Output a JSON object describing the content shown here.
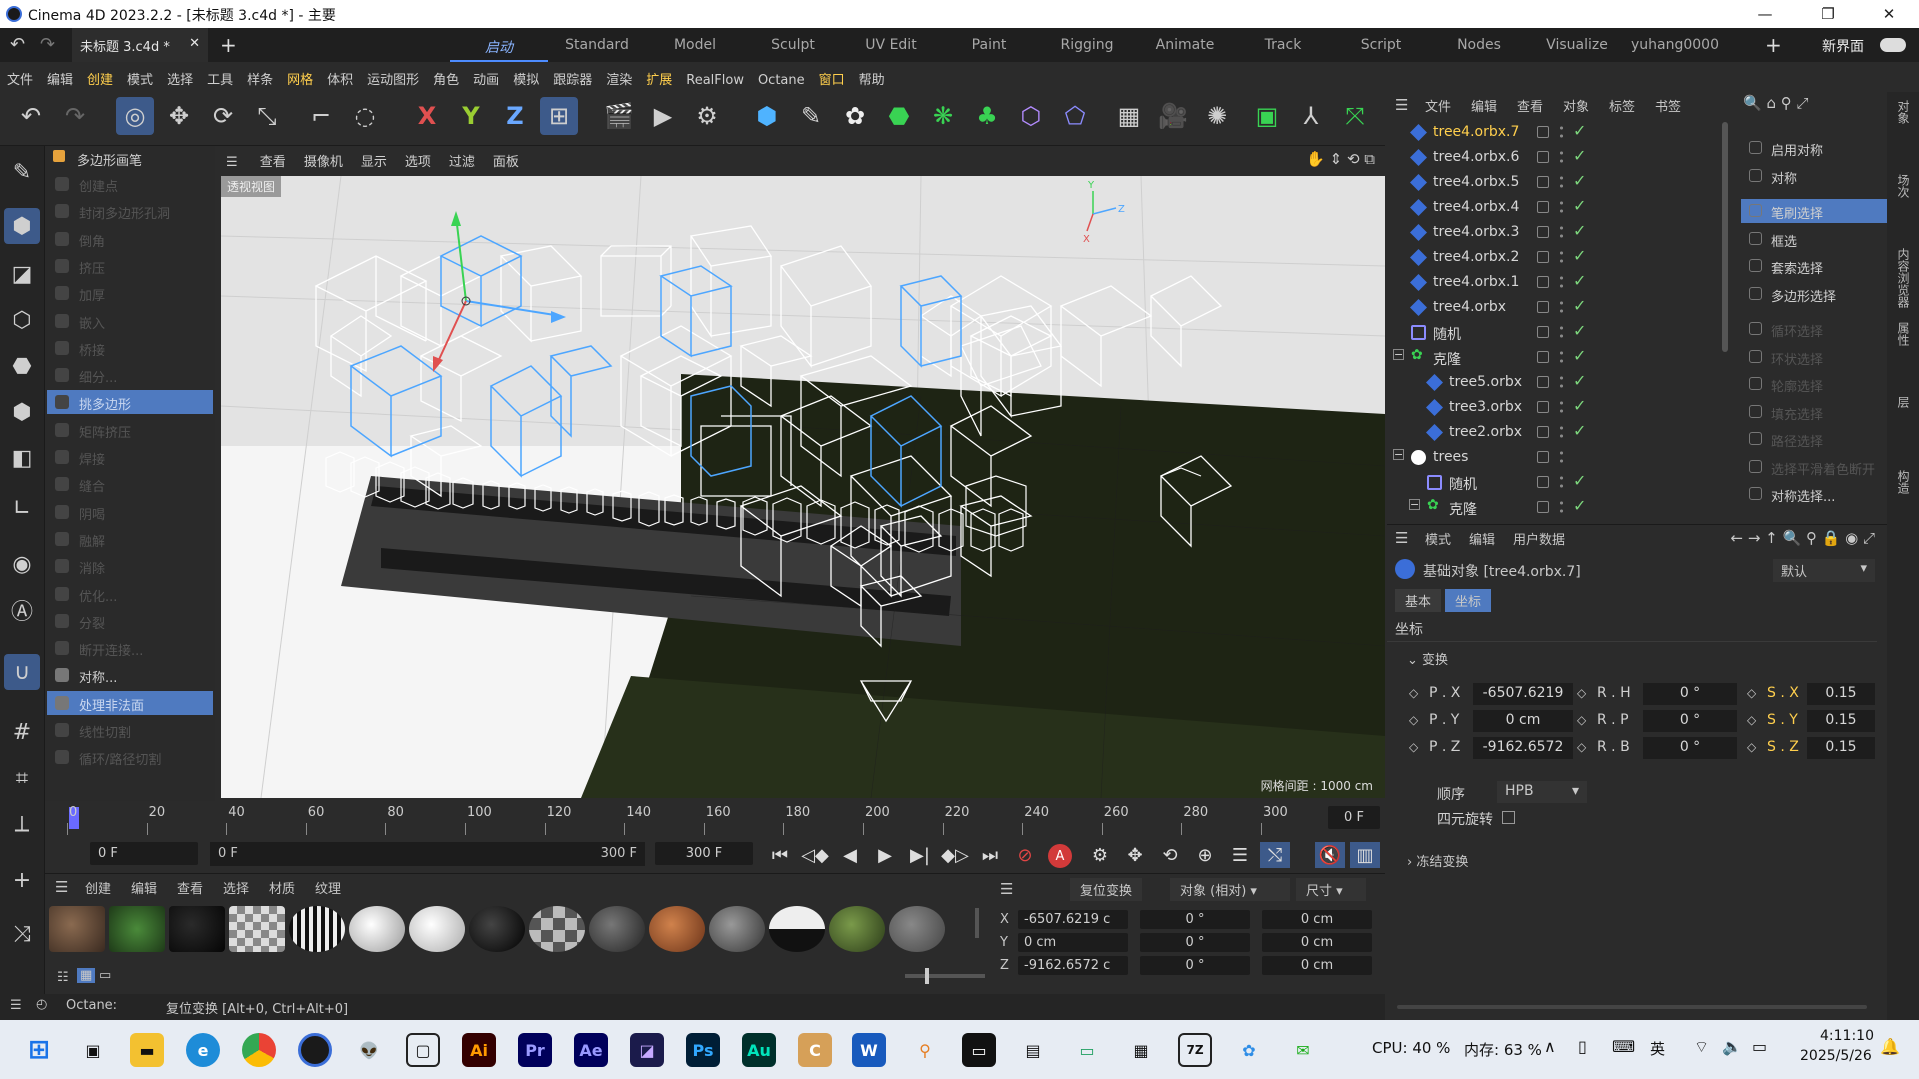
{
  "window": {
    "title": "Cinema 4D 2023.2.2 - [未标题 3.c4d *] - 主要"
  },
  "tabs": {
    "doc_tab": "未标题 3.c4d *",
    "layouts": [
      "启动",
      "Standard",
      "Model",
      "Sculpt",
      "UV Edit",
      "Paint",
      "Rigging",
      "Animate",
      "Track",
      "Script",
      "Nodes",
      "Visualize",
      "yuhang0000"
    ],
    "new_interface": "新界面"
  },
  "menu": [
    "文件",
    "编辑",
    "创建",
    "模式",
    "选择",
    "工具",
    "样条",
    "网格",
    "体积",
    "运动图形",
    "角色",
    "动画",
    "模拟",
    "跟踪器",
    "渲染",
    "扩展",
    "RealFlow",
    "Octane",
    "窗口",
    "帮助"
  ],
  "viewport": {
    "menu": [
      "查看",
      "摄像机",
      "显示",
      "选项",
      "过滤",
      "面板"
    ],
    "view_label": "透视视图",
    "grid_info": "网格间距 : 1000 cm"
  },
  "modeling": {
    "title": "多边形画笔",
    "items": [
      "创建点",
      "封闭多边形孔洞",
      "倒角",
      "挤压",
      "加厚",
      "嵌入",
      "桥接",
      "细分...",
      "挑多边形",
      "矩阵挤压",
      "焊接",
      "缝合",
      "阴喝",
      "融解",
      "消除",
      "优化...",
      "分裂",
      "断开连接...",
      "对称...",
      "处理非法面",
      "线性切割",
      "循环/路径切割"
    ]
  },
  "timeline": {
    "ticks": [
      "0",
      "20",
      "40",
      "60",
      "80",
      "100",
      "120",
      "140",
      "160",
      "180",
      "200",
      "220",
      "240",
      "260",
      "280",
      "300"
    ],
    "current_frame": "0 F"
  },
  "playback": {
    "start": "0 F",
    "range_start": "0 F",
    "range_end": "300 F",
    "end": "300 F"
  },
  "materials": {
    "menu": [
      "创建",
      "编辑",
      "查看",
      "选择",
      "材质",
      "纹理"
    ]
  },
  "coords": {
    "reset_button": "复位变换",
    "mode": "对象 (相对)",
    "size": "尺寸",
    "rows": [
      {
        "axis": "X",
        "pos": "-6507.6219 c",
        "rot": "0 °",
        "size": "0 cm"
      },
      {
        "axis": "Y",
        "pos": "0 cm",
        "rot": "0 °",
        "size": "0 cm"
      },
      {
        "axis": "Z",
        "pos": "-9162.6572 c",
        "rot": "0 °",
        "size": "0 cm"
      }
    ]
  },
  "status": {
    "octane": "Octane:",
    "hint": "复位变换 [Alt+0, Ctrl+Alt+0]"
  },
  "object_manager": {
    "menu": [
      "文件",
      "编辑",
      "查看",
      "对象",
      "标签",
      "书签"
    ],
    "objects": [
      {
        "name": "tree4.orbx.7",
        "indent": 0,
        "active": true
      },
      {
        "name": "tree4.orbx.6",
        "indent": 0
      },
      {
        "name": "tree4.orbx.5",
        "indent": 0
      },
      {
        "name": "tree4.orbx.4",
        "indent": 0
      },
      {
        "name": "tree4.orbx.3",
        "indent": 0
      },
      {
        "name": "tree4.orbx.2",
        "indent": 0
      },
      {
        "name": "tree4.orbx.1",
        "indent": 0
      },
      {
        "name": "tree4.orbx",
        "indent": 0
      },
      {
        "name": "随机",
        "indent": 0
      },
      {
        "name": "克隆",
        "indent": 0
      },
      {
        "name": "tree5.orbx",
        "indent": 1
      },
      {
        "name": "tree3.orbx",
        "indent": 1
      },
      {
        "name": "tree2.orbx",
        "indent": 1
      },
      {
        "name": "trees",
        "indent": 0
      },
      {
        "name": "随机",
        "indent": 1
      },
      {
        "name": "克隆",
        "indent": 1
      }
    ]
  },
  "selection_panel": {
    "items": [
      "启用对称",
      "对称",
      "笔刷选择",
      "框选",
      "套索选择",
      "多边形选择",
      "循环选择",
      "环状选择",
      "轮廓选择",
      "填充选择",
      "路径选择",
      "选择平滑着色断开",
      "对称选择..."
    ]
  },
  "attributes": {
    "menu": [
      "模式",
      "编辑",
      "用户数据"
    ],
    "object_title": "基础对象 [tree4.orbx.7]",
    "preset": "默认",
    "tabs": [
      "基本",
      "坐标"
    ],
    "section": "坐标",
    "group": "变换",
    "fields": [
      {
        "label": "P . X",
        "value": "-6507.6219",
        "rlabel": "R . H",
        "rvalue": "0 °",
        "slabel": "S . X",
        "svalue": "0.15"
      },
      {
        "label": "P . Y",
        "value": "0 cm",
        "rlabel": "R . P",
        "rvalue": "0 °",
        "slabel": "S . Y",
        "svalue": "0.15"
      },
      {
        "label": "P . Z",
        "value": "-9162.6572",
        "rlabel": "R . B",
        "rvalue": "0 °",
        "slabel": "S . Z",
        "svalue": "0.15"
      }
    ],
    "order_label": "顺序",
    "order_value": "HPB",
    "quat_label": "四元旋转",
    "freeze_label": "冻结变换"
  },
  "right_strip": [
    "对象",
    "场次",
    "内容浏览器",
    "属性",
    "层",
    "构造"
  ],
  "taskbar": {
    "cpu": "CPU: 40 %",
    "mem": "内存: 63 %",
    "ime": "英",
    "time": "4:11:10",
    "date": "2025/5/26"
  },
  "colors": {
    "accent": "#4f7ac0",
    "highlight_text": "#ffcf4d",
    "check": "#7dd67d"
  }
}
